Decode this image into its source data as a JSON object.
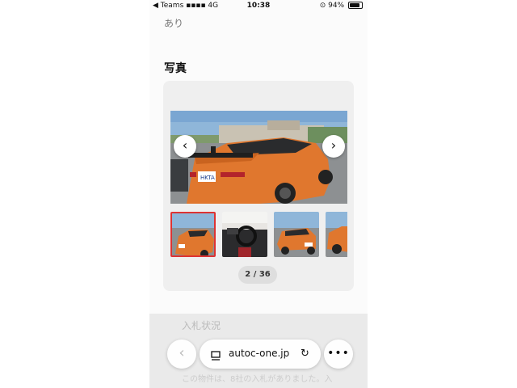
{
  "status_bar": {
    "carrier": "◀ Teams",
    "network": "4G",
    "time": "10:38",
    "battery": "94%"
  },
  "page": {
    "availability_text": "あり",
    "photos_title": "写真",
    "photo_counter": "2 / 36",
    "bid_section_title": "入札状況",
    "bid_text": "この物件は、8社の入札がありました。入"
  },
  "gallery": {
    "prev_label": "‹",
    "next_label": "›",
    "current_index": 2,
    "total": 36,
    "thumbnails": [
      "thumb-1",
      "thumb-2",
      "thumb-3",
      "thumb-4"
    ],
    "plate_text": "HKTA"
  },
  "browser_toolbar": {
    "url": "autoc-one.jp",
    "back_label": "‹",
    "more_label": "•••",
    "reload_icon": "↻"
  },
  "colors": {
    "car_orange": "#e0772e",
    "active_thumb_border": "#dd3333"
  }
}
